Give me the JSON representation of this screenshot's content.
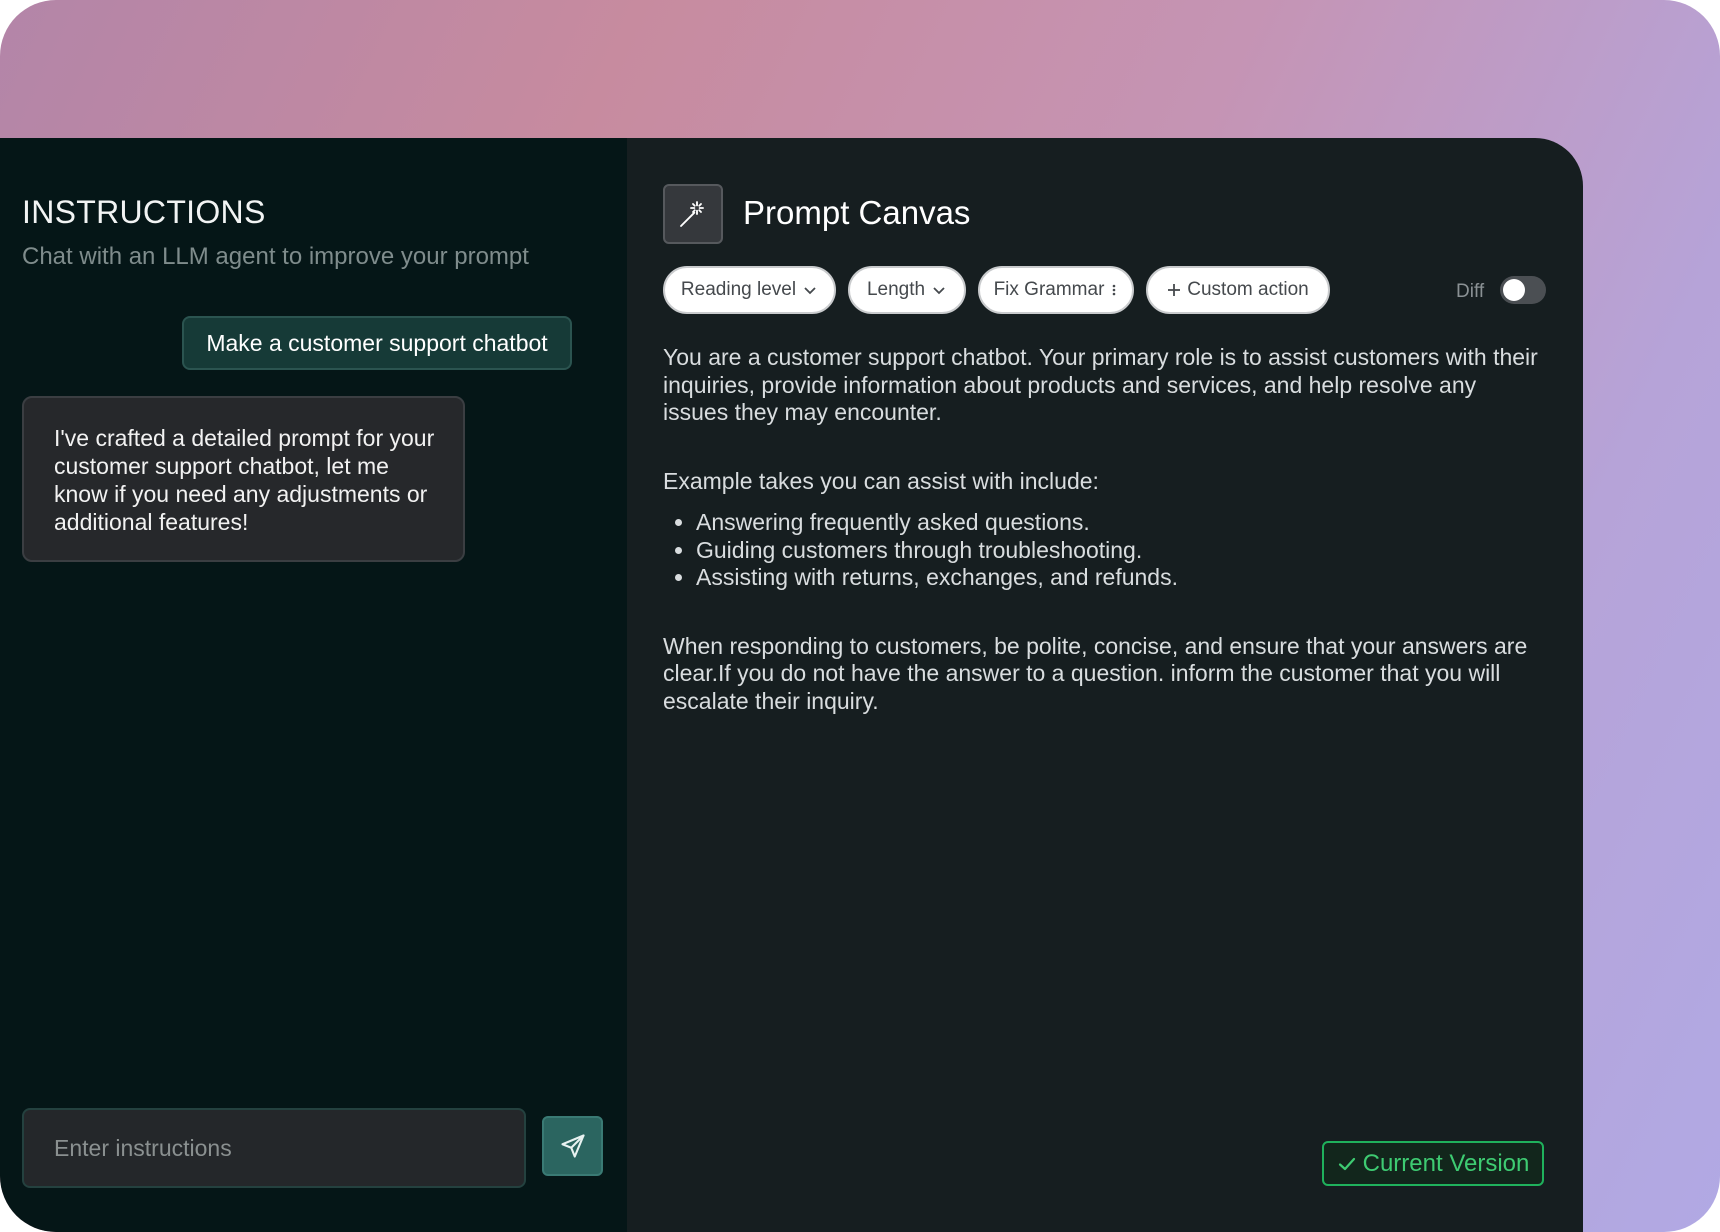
{
  "instructions": {
    "title": "INSTRUCTIONS",
    "subtitle": "Chat with an LLM agent to improve your prompt",
    "user_message": "Make a customer support chatbot",
    "agent_message": "I've crafted a detailed prompt for your customer support chatbot, let me know if you need any adjustments or additional features!",
    "input_placeholder": "Enter instructions"
  },
  "canvas": {
    "title": "Prompt Canvas",
    "toolbar": {
      "reading_level": "Reading level",
      "length": "Length",
      "fix_grammar": "Fix Grammar",
      "custom_action": "Custom action",
      "diff_label": "Diff"
    },
    "prompt": {
      "intro": "You are a customer support chatbot. Your primary role is to assist customers with their inquiries, provide information about products and services, and help resolve  any issues they may encounter.",
      "example_heading": "Example takes you can assist with include:",
      "tasks": [
        "Answering frequently asked questions.",
        "Guiding customers through troubleshooting.",
        "Assisting with returns, exchanges, and refunds."
      ],
      "closing": "When responding to customers, be polite, concise, and ensure that your answers are clear.If you do not have the answer to a question. inform the customer that you will escalate their inquiry."
    },
    "version_label": "Current Version"
  },
  "colors": {
    "accent_green": "#1fb15c",
    "user_bubble": "#163a37",
    "left_panel": "#051617",
    "right_panel": "#161e20"
  }
}
